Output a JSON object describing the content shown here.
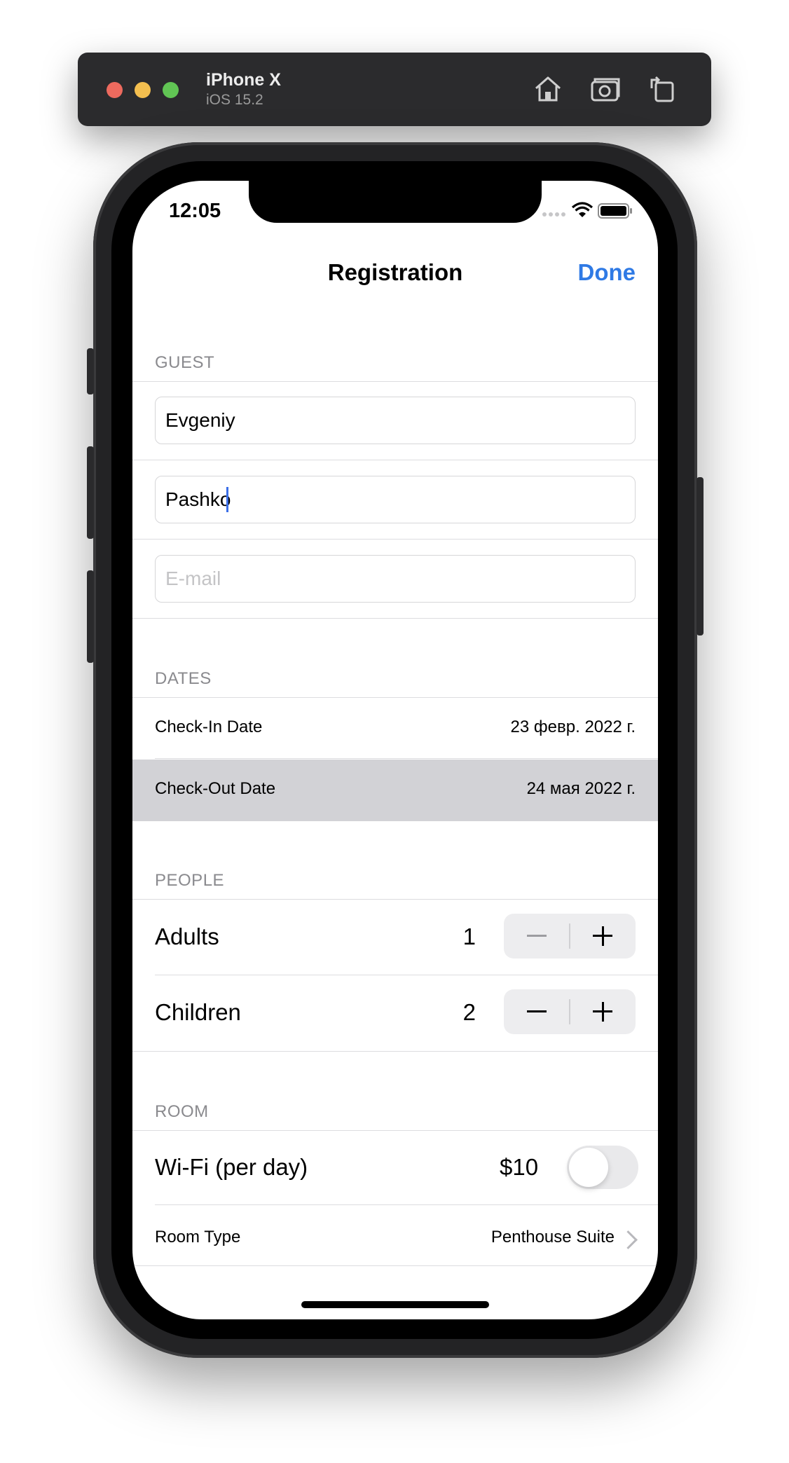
{
  "simulator": {
    "device": "iPhone X",
    "os": "iOS 15.2",
    "icons": [
      "home-icon",
      "screenshot-icon",
      "rotate-icon"
    ]
  },
  "status_bar": {
    "time": "12:05",
    "icons": [
      "signal-icon",
      "wifi-icon",
      "battery-icon"
    ]
  },
  "nav": {
    "title": "Registration",
    "done_label": "Done",
    "accent_color": "#2f7ae5"
  },
  "guest": {
    "header": "GUEST",
    "first_name": "Evgeniy",
    "last_name": "Pashko",
    "email_placeholder": "E-mail",
    "email_value": ""
  },
  "dates": {
    "header": "DATES",
    "check_in_label": "Check-In Date",
    "check_in_value": "23 февр. 2022 г.",
    "check_out_label": "Check-Out Date",
    "check_out_value": "24 мая 2022 г.",
    "check_out_selected": true
  },
  "people": {
    "header": "PEOPLE",
    "adults_label": "Adults",
    "adults_count": "1",
    "adults_minus_enabled": false,
    "children_label": "Children",
    "children_count": "2",
    "children_minus_enabled": true
  },
  "room": {
    "header": "ROOM",
    "wifi_label": "Wi-Fi (per day)",
    "wifi_price": "$10",
    "wifi_enabled": false,
    "room_type_label": "Room Type",
    "room_type_value": "Penthouse Suite"
  }
}
